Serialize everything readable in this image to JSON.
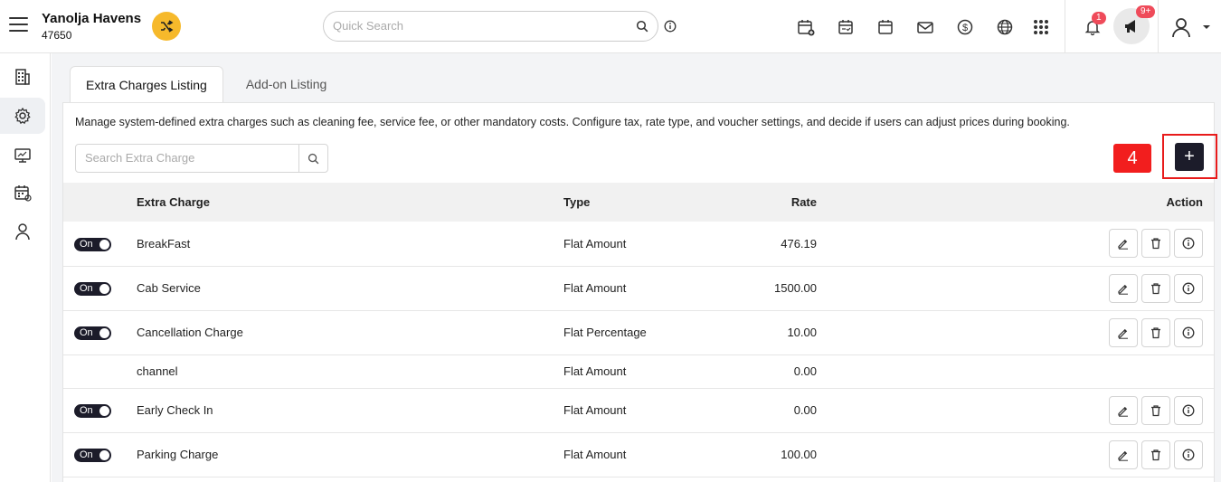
{
  "header": {
    "hotel_name": "Yanolja Havens",
    "hotel_id": "47650",
    "search_placeholder": "Quick Search",
    "notifications_count": "1",
    "announcements_count": "9+"
  },
  "sidebar": {
    "items": [
      {
        "icon": "building-icon"
      },
      {
        "icon": "settings-icon"
      },
      {
        "icon": "monitor-icon"
      },
      {
        "icon": "calendar-icon"
      },
      {
        "icon": "user-icon"
      }
    ]
  },
  "tabs": [
    {
      "label": "Extra Charges Listing",
      "active": true
    },
    {
      "label": "Add-on Listing",
      "active": false
    }
  ],
  "page": {
    "description": "Manage system-defined extra charges such as cleaning fee, service fee, or other mandatory costs. Configure tax, rate type, and voucher settings, and decide if users can adjust prices during booking.",
    "search_placeholder": "Search Extra Charge",
    "step_number": "4",
    "add_label": "+"
  },
  "table": {
    "headers": {
      "name": "Extra Charge",
      "type": "Type",
      "rate": "Rate",
      "action": "Action"
    },
    "toggle_on_label": "On",
    "rows": [
      {
        "toggle": true,
        "name": "BreakFast",
        "type": "Flat Amount",
        "rate": "476.19",
        "actions": true
      },
      {
        "toggle": true,
        "name": "Cab Service",
        "type": "Flat Amount",
        "rate": "1500.00",
        "actions": true
      },
      {
        "toggle": true,
        "name": "Cancellation Charge",
        "type": "Flat Percentage",
        "rate": "10.00",
        "actions": true
      },
      {
        "toggle": false,
        "name": "channel",
        "type": "Flat Amount",
        "rate": "0.00",
        "actions": false
      },
      {
        "toggle": true,
        "name": "Early Check In",
        "type": "Flat Amount",
        "rate": "0.00",
        "actions": true
      },
      {
        "toggle": true,
        "name": "Parking Charge",
        "type": "Flat Amount",
        "rate": "100.00",
        "actions": true
      }
    ]
  },
  "colors": {
    "accent_dark": "#1c1c2a",
    "badge_red": "#ef4b5a",
    "highlight_red": "#e81b1b",
    "switch_yellow": "#f6b92b"
  }
}
